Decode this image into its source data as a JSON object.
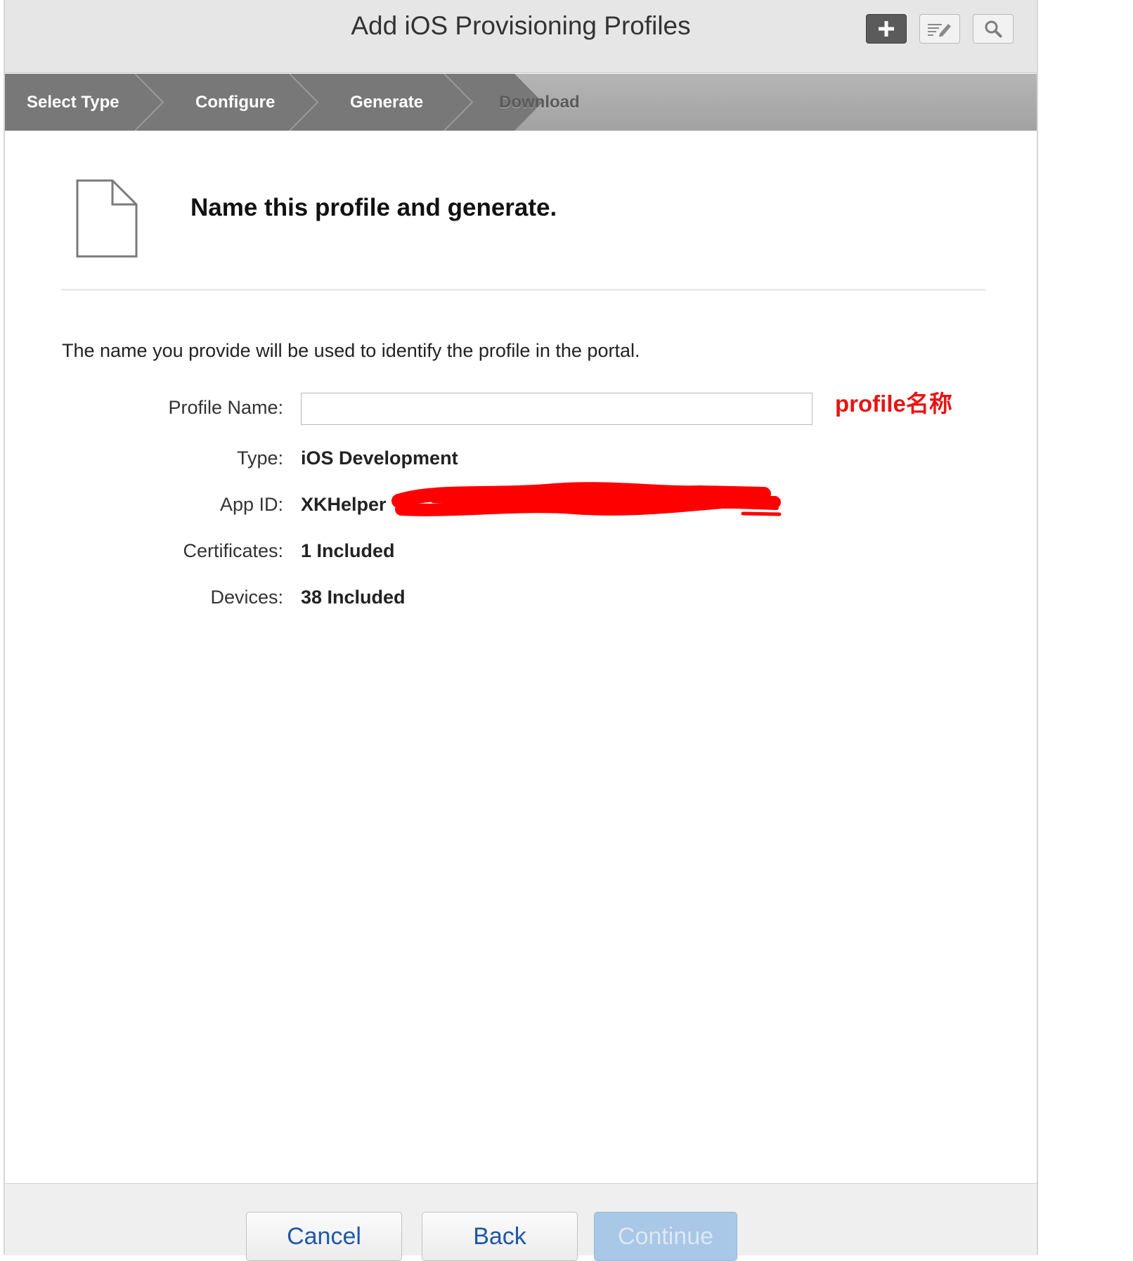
{
  "header": {
    "title": "Add iOS Provisioning Profiles",
    "buttons": [
      {
        "name": "add",
        "icon": "plus-icon"
      },
      {
        "name": "edit",
        "icon": "edit-icon"
      },
      {
        "name": "search",
        "icon": "search-icon"
      }
    ]
  },
  "steps": [
    {
      "label": "Select Type",
      "state": "completed"
    },
    {
      "label": "Configure",
      "state": "completed"
    },
    {
      "label": "Generate",
      "state": "current"
    },
    {
      "label": "Download",
      "state": "pending"
    }
  ],
  "main": {
    "icon": "document-icon",
    "heading": "Name this profile and generate.",
    "description": "The name you provide will be used to identify the profile in the portal.",
    "fields": {
      "profile_name": {
        "label": "Profile Name:",
        "value": "",
        "placeholder": ""
      },
      "type": {
        "label": "Type:",
        "value": "iOS Development"
      },
      "app_id": {
        "label": "App ID:",
        "value": "XKHelper"
      },
      "certificates": {
        "label": "Certificates:",
        "value": "1 Included"
      },
      "devices": {
        "label": "Devices:",
        "value": "38 Included"
      }
    },
    "annotation": "profile名称"
  },
  "footer": {
    "cancel_label": "Cancel",
    "back_label": "Back",
    "continue_label": "Continue"
  },
  "colors": {
    "step_completed": "#787878",
    "step_pending": "#a8a8a8",
    "link_blue": "#1f57a8",
    "annotation_red": "#e81414",
    "continue_disabled": "#a9c7e6"
  }
}
